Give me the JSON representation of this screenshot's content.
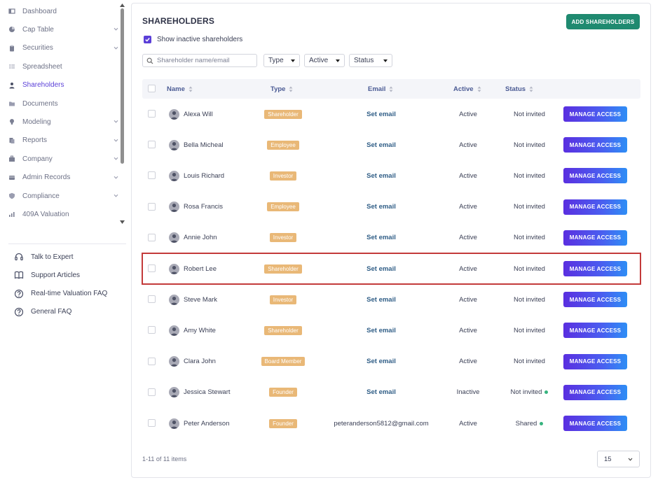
{
  "sidebar": {
    "nav": [
      {
        "label": "Dashboard",
        "icon": "dashboard-icon",
        "expandable": false
      },
      {
        "label": "Cap Table",
        "icon": "pie-chart-icon",
        "expandable": true
      },
      {
        "label": "Securities",
        "icon": "clipboard-icon",
        "expandable": true
      },
      {
        "label": "Spreadsheet",
        "icon": "spreadsheet-icon",
        "expandable": false
      },
      {
        "label": "Shareholders",
        "icon": "user-icon",
        "expandable": false,
        "active": true
      },
      {
        "label": "Documents",
        "icon": "folder-icon",
        "expandable": false
      },
      {
        "label": "Modeling",
        "icon": "lightbulb-icon",
        "expandable": true
      },
      {
        "label": "Reports",
        "icon": "reports-icon",
        "expandable": true
      },
      {
        "label": "Company",
        "icon": "company-icon",
        "expandable": true
      },
      {
        "label": "Admin Records",
        "icon": "admin-records-icon",
        "expandable": true
      },
      {
        "label": "Compliance",
        "icon": "shield-icon",
        "expandable": true
      },
      {
        "label": "409A Valuation",
        "icon": "valuation-chart-icon",
        "expandable": false
      }
    ],
    "help": [
      {
        "label": "Talk to Expert",
        "icon": "headset-icon"
      },
      {
        "label": "Support Articles",
        "icon": "book-icon"
      },
      {
        "label": "Real-time Valuation FAQ",
        "icon": "question-icon"
      },
      {
        "label": "General FAQ",
        "icon": "question-icon"
      }
    ]
  },
  "header": {
    "title": "SHAREHOLDERS",
    "add_button": "ADD SHAREHOLDERS",
    "show_inactive_label": "Show inactive shareholders",
    "show_inactive_checked": true
  },
  "filters": {
    "search_placeholder": "Shareholder name/email",
    "type_label": "Type",
    "active_label": "Active",
    "status_label": "Status"
  },
  "table": {
    "columns": {
      "name": "Name",
      "type": "Type",
      "email": "Email",
      "active": "Active",
      "status": "Status"
    },
    "rows": [
      {
        "name": "Alexa Will",
        "type": "Shareholder",
        "email": "Set email",
        "email_is_link": true,
        "active": "Active",
        "status": "Not invited",
        "status_dot": false,
        "action": "MANAGE ACCESS"
      },
      {
        "name": "Bella Micheal",
        "type": "Employee",
        "email": "Set email",
        "email_is_link": true,
        "active": "Active",
        "status": "Not invited",
        "status_dot": false,
        "action": "MANAGE ACCESS"
      },
      {
        "name": "Louis Richard",
        "type": "Investor",
        "email": "Set email",
        "email_is_link": true,
        "active": "Active",
        "status": "Not invited",
        "status_dot": false,
        "action": "MANAGE ACCESS"
      },
      {
        "name": "Rosa Francis",
        "type": "Employee",
        "email": "Set email",
        "email_is_link": true,
        "active": "Active",
        "status": "Not invited",
        "status_dot": false,
        "action": "MANAGE ACCESS"
      },
      {
        "name": "Annie John",
        "type": "Investor",
        "email": "Set email",
        "email_is_link": true,
        "active": "Active",
        "status": "Not invited",
        "status_dot": false,
        "action": "MANAGE ACCESS"
      },
      {
        "name": "Robert Lee",
        "type": "Shareholder",
        "email": "Set email",
        "email_is_link": true,
        "active": "Active",
        "status": "Not invited",
        "status_dot": false,
        "action": "MANAGE ACCESS",
        "highlighted": true
      },
      {
        "name": "Steve Mark",
        "type": "Investor",
        "email": "Set email",
        "email_is_link": true,
        "active": "Active",
        "status": "Not invited",
        "status_dot": false,
        "action": "MANAGE ACCESS"
      },
      {
        "name": "Amy White",
        "type": "Shareholder",
        "email": "Set email",
        "email_is_link": true,
        "active": "Active",
        "status": "Not invited",
        "status_dot": false,
        "action": "MANAGE ACCESS"
      },
      {
        "name": "Clara John",
        "type": "Board Member",
        "email": "Set email",
        "email_is_link": true,
        "active": "Active",
        "status": "Not invited",
        "status_dot": false,
        "action": "MANAGE ACCESS"
      },
      {
        "name": "Jessica Stewart",
        "type": "Founder",
        "email": "Set email",
        "email_is_link": true,
        "active": "Inactive",
        "status": "Not invited",
        "status_dot": true,
        "action": "MANAGE ACCESS"
      },
      {
        "name": "Peter Anderson",
        "type": "Founder",
        "email": "peteranderson5812@gmail.com",
        "email_is_link": false,
        "active": "Active",
        "status": "Shared",
        "status_dot": true,
        "action": "MANAGE ACCESS"
      }
    ]
  },
  "pagination": {
    "summary": "1-11 of 11 items",
    "page_size": "15"
  },
  "colors": {
    "accent": "#5a3fd8",
    "add_button": "#1f8a70",
    "type_tag": "#e9b877",
    "link": "#2f5d86",
    "status_dot": "#36b37e",
    "highlight_border": "#c33a3a"
  }
}
